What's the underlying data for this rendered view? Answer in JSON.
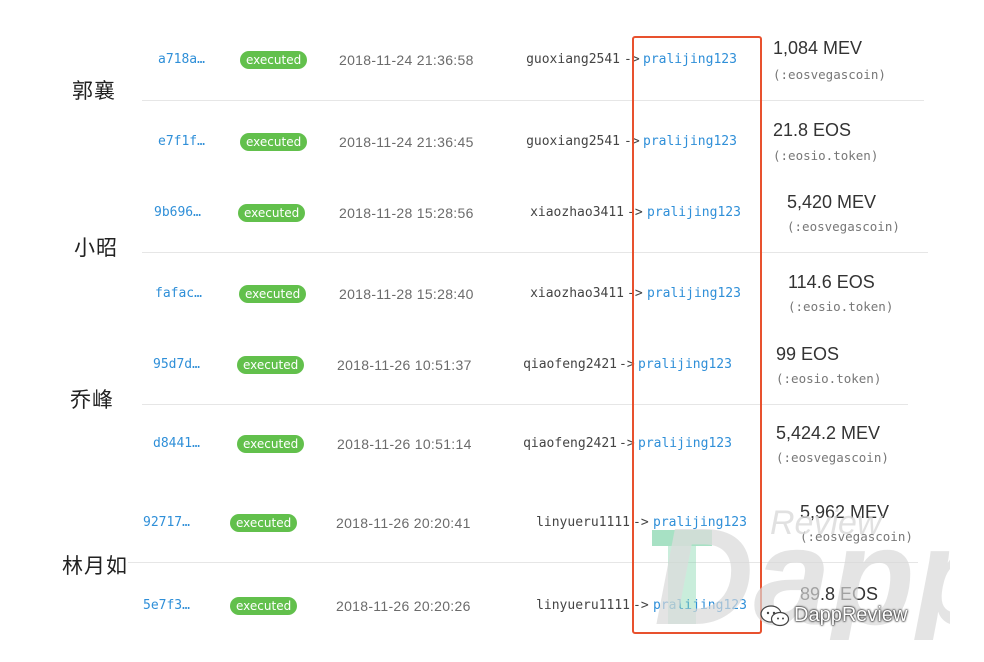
{
  "groups": [
    {
      "label": "郭襄"
    },
    {
      "label": "小昭"
    },
    {
      "label": "乔峰"
    },
    {
      "label": "林月如"
    }
  ],
  "rows": [
    {
      "hash": "a718a…",
      "status": "executed",
      "time": "2018-11-24 21:36:58",
      "from": "guoxiang2541",
      "arrow": "->",
      "to": "pralijing123",
      "amount": "1,084 MEV",
      "contract": "(:eosvegascoin)"
    },
    {
      "hash": "e7f1f…",
      "status": "executed",
      "time": "2018-11-24 21:36:45",
      "from": "guoxiang2541",
      "arrow": "->",
      "to": "pralijing123",
      "amount": "21.8 EOS",
      "contract": "(:eosio.token)"
    },
    {
      "hash": "9b696…",
      "status": "executed",
      "time": "2018-11-28 15:28:56",
      "from": "xiaozhao3411",
      "arrow": "->",
      "to": "pralijing123",
      "amount": "5,420 MEV",
      "contract": "(:eosvegascoin)"
    },
    {
      "hash": "fafac…",
      "status": "executed",
      "time": "2018-11-28 15:28:40",
      "from": "xiaozhao3411",
      "arrow": "->",
      "to": "pralijing123",
      "amount": "114.6 EOS",
      "contract": "(:eosio.token)"
    },
    {
      "hash": "95d7d…",
      "status": "executed",
      "time": "2018-11-26 10:51:37",
      "from": "qiaofeng2421",
      "arrow": "->",
      "to": "pralijing123",
      "amount": "99 EOS",
      "contract": "(:eosio.token)"
    },
    {
      "hash": "d8441…",
      "status": "executed",
      "time": "2018-11-26 10:51:14",
      "from": "qiaofeng2421",
      "arrow": "->",
      "to": "pralijing123",
      "amount": "5,424.2 MEV",
      "contract": "(:eosvegascoin)"
    },
    {
      "hash": "92717…",
      "status": "executed",
      "time": "2018-11-26 20:20:41",
      "from": "linyueru1111",
      "arrow": "->",
      "to": "pralijing123",
      "amount": "5,962 MEV",
      "contract": "(:eosvegascoin)"
    },
    {
      "hash": "5e7f3…",
      "status": "executed",
      "time": "2018-11-26 20:20:26",
      "from": "linyueru1111",
      "arrow": "->",
      "to": "pralijing123",
      "amount": "89.8 EOS",
      "contract": ""
    }
  ],
  "watermark": {
    "logo_word": "Dapp",
    "logo_sub": "Review",
    "credit": "DappReview",
    "icon": "wechat-icon"
  },
  "colors": {
    "link": "#2f8fd8",
    "badge": "#62c04c",
    "highlight": "#e8512e"
  }
}
